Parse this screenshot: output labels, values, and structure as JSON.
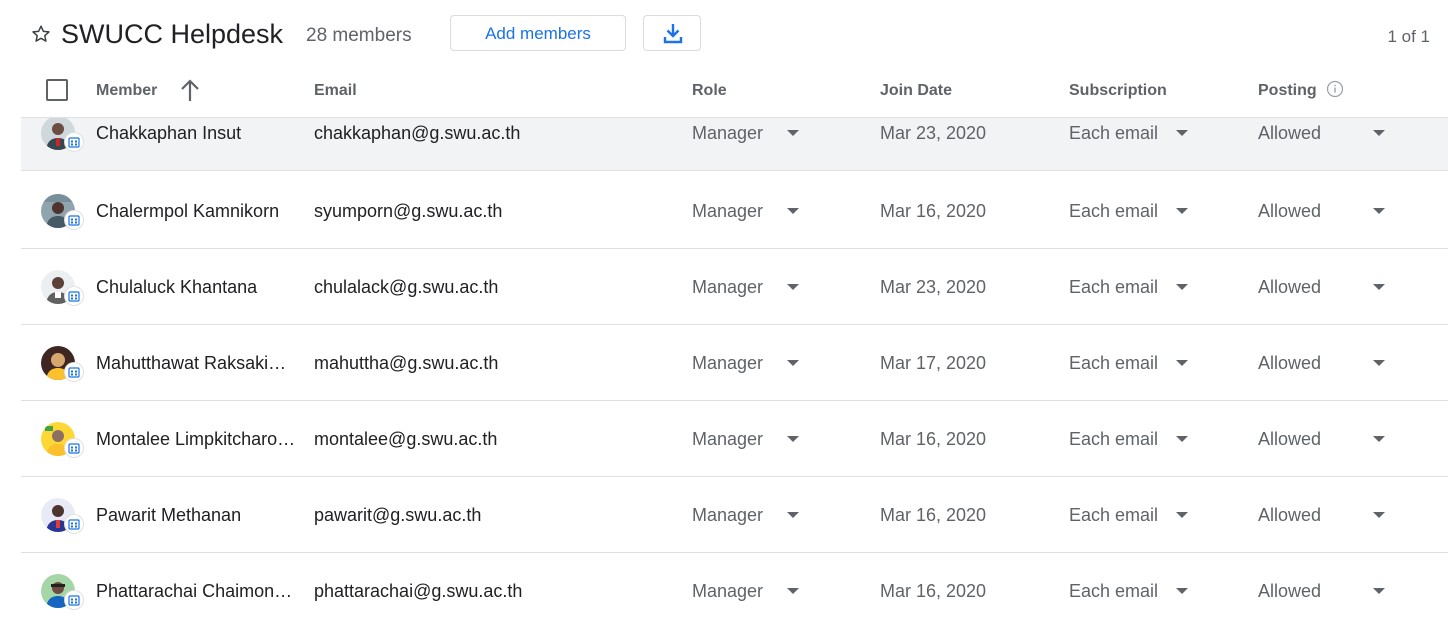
{
  "header": {
    "title": "SWUCC Helpdesk",
    "member_count": "28 members",
    "add_members_label": "Add members",
    "pagination": "1 of 1"
  },
  "columns": {
    "member": "Member",
    "email": "Email",
    "role": "Role",
    "join_date": "Join Date",
    "subscription": "Subscription",
    "posting": "Posting"
  },
  "colors": {
    "accent": "#1a73e8",
    "text_secondary": "#5f6368",
    "row_hover": "#f1f3f4",
    "divider": "#e0e0e0"
  },
  "members": [
    {
      "name": "Chakkaphan Insut",
      "email": "chakkaphan@g.swu.ac.th",
      "role": "Manager",
      "join_date": "Mar 23, 2020",
      "subscription": "Each email",
      "posting": "Allowed"
    },
    {
      "name": "Chalermpol Kamnikorn",
      "email": "syumporn@g.swu.ac.th",
      "role": "Manager",
      "join_date": "Mar 16, 2020",
      "subscription": "Each email",
      "posting": "Allowed"
    },
    {
      "name": "Chulaluck Khantana",
      "email": "chulalack@g.swu.ac.th",
      "role": "Manager",
      "join_date": "Mar 23, 2020",
      "subscription": "Each email",
      "posting": "Allowed"
    },
    {
      "name": "Mahutthawat Raksakiet…",
      "email": "mahuttha@g.swu.ac.th",
      "role": "Manager",
      "join_date": "Mar 17, 2020",
      "subscription": "Each email",
      "posting": "Allowed"
    },
    {
      "name": "Montalee Limpkitcharo…",
      "email": "montalee@g.swu.ac.th",
      "role": "Manager",
      "join_date": "Mar 16, 2020",
      "subscription": "Each email",
      "posting": "Allowed"
    },
    {
      "name": "Pawarit Methanan",
      "email": "pawarit@g.swu.ac.th",
      "role": "Manager",
      "join_date": "Mar 16, 2020",
      "subscription": "Each email",
      "posting": "Allowed"
    },
    {
      "name": "Phattarachai Chaimong…",
      "email": "phattarachai@g.swu.ac.th",
      "role": "Manager",
      "join_date": "Mar 16, 2020",
      "subscription": "Each email",
      "posting": "Allowed"
    }
  ]
}
